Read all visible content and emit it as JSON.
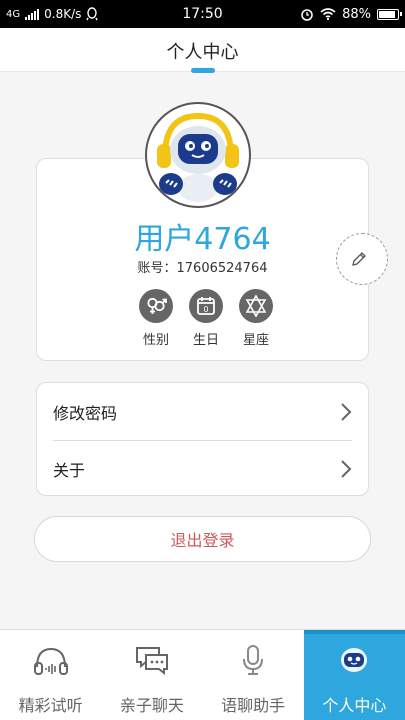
{
  "status_bar": {
    "network": "4G",
    "speed": "0.8K/s",
    "time": "17:50",
    "battery": "88%",
    "battery_level": 0.88
  },
  "header": {
    "title": "个人中心"
  },
  "profile": {
    "username": "用户4764",
    "account": "账号：17606524764",
    "attributes": [
      {
        "label": "性别",
        "icon": "gender-icon"
      },
      {
        "label": "生日",
        "icon": "calendar-icon"
      },
      {
        "label": "星座",
        "icon": "star-of-david-icon"
      }
    ]
  },
  "menu": {
    "items": [
      {
        "label": "修改密码"
      },
      {
        "label": "关于"
      }
    ]
  },
  "logout_label": "退出登录",
  "tabs": [
    {
      "label": "精彩试听",
      "icon": "headphones-icon",
      "active": false
    },
    {
      "label": "亲子聊天",
      "icon": "chat-bubble-icon",
      "active": false
    },
    {
      "label": "语聊助手",
      "icon": "microphone-icon",
      "active": false
    },
    {
      "label": "个人中心",
      "icon": "robot-icon",
      "active": true
    }
  ],
  "colors": {
    "accent": "#2da7dd",
    "logout_text": "#cc5a5a",
    "attribute_icon_bg": "#666666"
  }
}
